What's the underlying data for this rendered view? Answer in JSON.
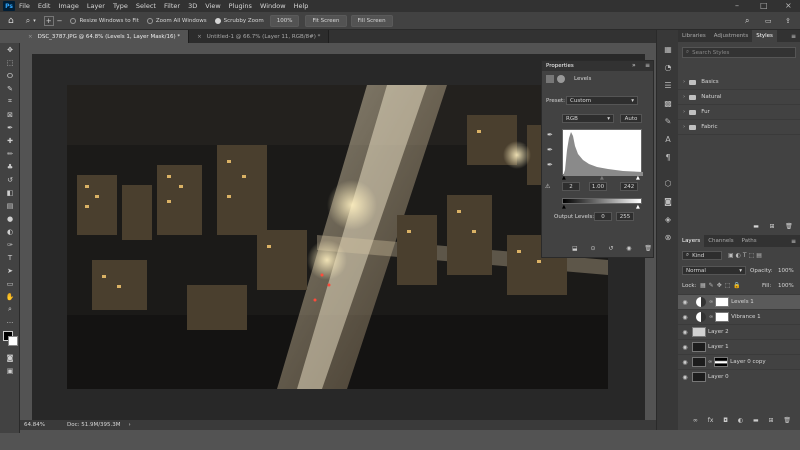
{
  "app": {
    "logo": "Ps"
  },
  "menu": [
    "File",
    "Edit",
    "Image",
    "Layer",
    "Type",
    "Select",
    "Filter",
    "3D",
    "View",
    "Plugins",
    "Window",
    "Help"
  ],
  "options": {
    "resize_windows": "Resize Windows to Fit",
    "zoom_all": "Zoom All Windows",
    "scrubby_zoom": "Scrubby Zoom",
    "zoom_value": "100%",
    "fit_screen": "Fit Screen",
    "fill_screen": "Fill Screen"
  },
  "tabs": [
    {
      "label": "DSC_3787.JPG @ 64.8% (Levels 1, Layer Mask/16) *"
    },
    {
      "label": "Untitled-1 @ 66.7% (Layer 11, RGB/8#) *"
    }
  ],
  "status": {
    "zoom": "64.84%",
    "doc": "Doc: 51.9M/395.3M"
  },
  "properties": {
    "title": "Properties",
    "section": "Levels",
    "preset_label": "Preset:",
    "preset_value": "Custom",
    "channel": "RGB",
    "auto": "Auto",
    "input_black": "2",
    "input_gamma": "1.00",
    "input_white": "242",
    "output_label": "Output Levels:",
    "output_black": "0",
    "output_white": "255"
  },
  "libraries_tabs": [
    "Libraries",
    "Adjustments",
    "Styles"
  ],
  "styles": {
    "search_placeholder": "Search Styles",
    "folders": [
      "Basics",
      "Natural",
      "Fur",
      "Fabric"
    ]
  },
  "layers_panel": {
    "tabs": [
      "Layers",
      "Channels",
      "Paths"
    ],
    "kind": "Kind",
    "blend_mode": "Normal",
    "opacity_label": "Opacity:",
    "opacity_value": "100%",
    "lock_label": "Lock:",
    "fill_label": "Fill:",
    "fill_value": "100%",
    "layers": [
      {
        "name": "Levels 1"
      },
      {
        "name": "Vibrance 1"
      },
      {
        "name": "Layer 2"
      },
      {
        "name": "Layer 1"
      },
      {
        "name": "Layer 0 copy"
      },
      {
        "name": "Layer 0"
      }
    ]
  },
  "icons": {
    "home": "home-icon",
    "zoom": "zoom-icon",
    "eye": "eye-icon"
  },
  "colors": {
    "accent": "#31a8ff",
    "menubar": "#323232",
    "panel": "#424242"
  }
}
